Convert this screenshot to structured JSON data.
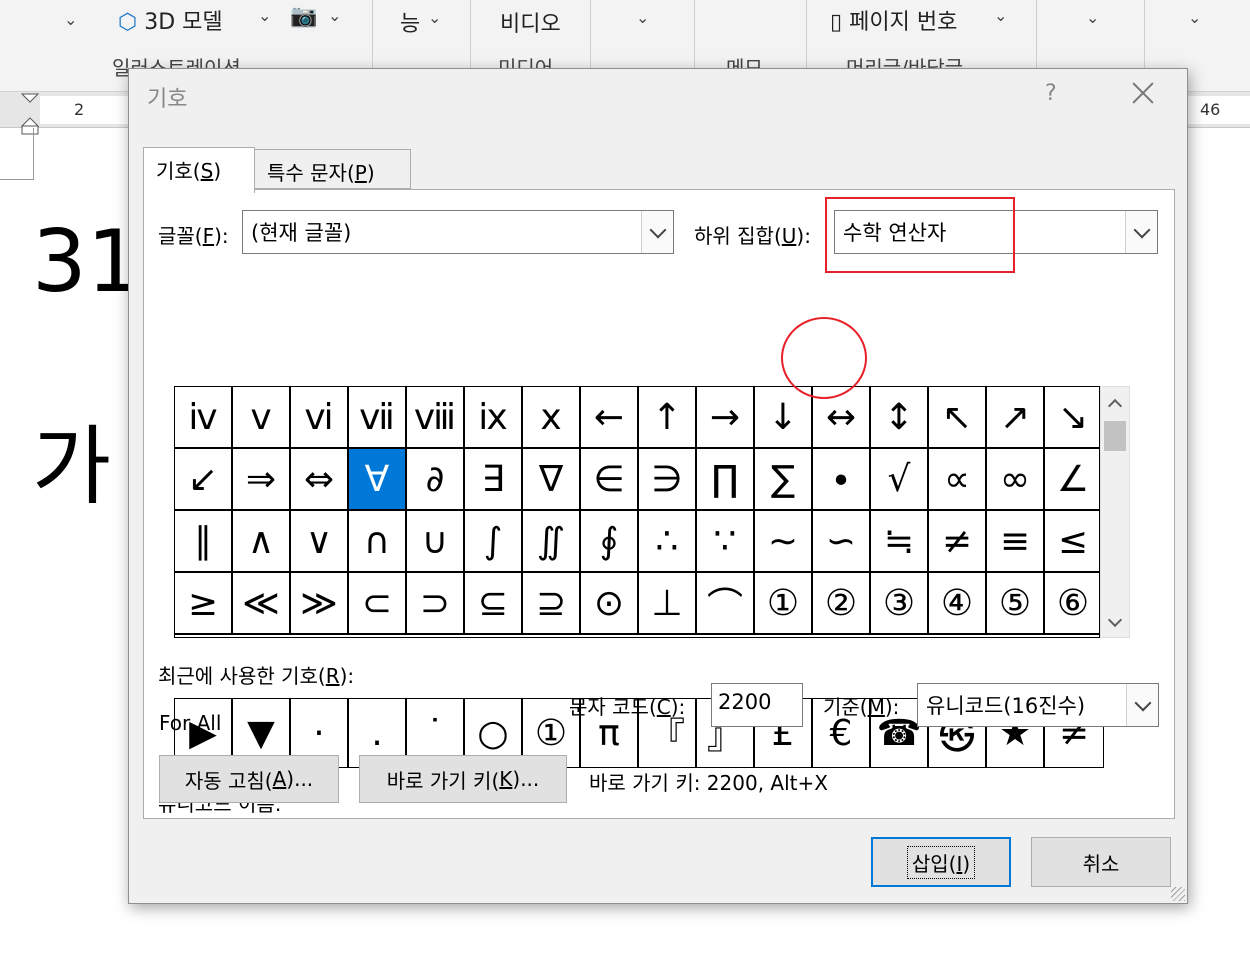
{
  "ribbon": {
    "model_3d_label": "3D 모델",
    "functions_label": "능",
    "video_label": "비디오",
    "page_number_label": "페이지 번호",
    "group_illustrations": "일러스트레이션",
    "group_media": "미디어",
    "group_memo": "메모",
    "group_header_footer": "머리글/바닥글"
  },
  "ruler": {
    "left_num": "2",
    "right_num": "46"
  },
  "document": {
    "line1": "31",
    "line2": "가"
  },
  "dialog": {
    "title": "기호",
    "help": "?",
    "tabs": [
      {
        "label": "기호(",
        "key": "S",
        "suffix": ")"
      },
      {
        "label": "특수 문자(",
        "key": "P",
        "suffix": ")"
      }
    ],
    "font_label": {
      "text": "글꼴(",
      "key": "F",
      "suffix": "):"
    },
    "font_value": "(현재 글꼴)",
    "subset_label": {
      "text": "하위 집합(",
      "key": "U",
      "suffix": "):"
    },
    "subset_value": "수학 연산자",
    "symbols": [
      "ⅳ",
      "ⅴ",
      "ⅵ",
      "ⅶ",
      "ⅷ",
      "ⅸ",
      "ⅹ",
      "←",
      "↑",
      "→",
      "↓",
      "↔",
      "↕",
      "↖",
      "↗",
      "↘",
      "↙",
      "⇒",
      "⇔",
      "∀",
      "∂",
      "∃",
      "∇",
      "∈",
      "∋",
      "∏",
      "∑",
      "∙",
      "√",
      "∝",
      "∞",
      "∠",
      "∥",
      "∧",
      "∨",
      "∩",
      "∪",
      "∫",
      "∬",
      "∮",
      "∴",
      "∵",
      "∼",
      "∽",
      "≒",
      "≠",
      "≡",
      "≤",
      "≥",
      "≪",
      "≫",
      "⊂",
      "⊃",
      "⊆",
      "⊇",
      "⊙",
      "⊥",
      "⌒",
      "①",
      "②",
      "③",
      "④",
      "⑤",
      "⑥"
    ],
    "selected_symbol": "∀",
    "recent_label": {
      "text": "최근에 사용한 기호(",
      "key": "R",
      "suffix": "):"
    },
    "recent_symbols": [
      "▶",
      "▼",
      "·",
      "․",
      "˙",
      "○",
      "①",
      "π",
      "『",
      "』",
      "£",
      "€",
      "☎",
      "㉿",
      "★",
      "≠"
    ],
    "unicode_name_label": "유니코드 이름:",
    "unicode_name_value": "For All",
    "char_code_label": {
      "text": "문자 코드(",
      "key": "C",
      "suffix": "):"
    },
    "char_code_value": "2200",
    "from_label": {
      "text": "기준(",
      "key": "M",
      "suffix": "):"
    },
    "from_value": "유니코드(16진수)",
    "autocorrect_button": {
      "text": "자동 고침(",
      "key": "A",
      "suffix": ")..."
    },
    "shortcut_key_button": {
      "text": "바로 가기 키(",
      "key": "K",
      "suffix": ")..."
    },
    "shortcut_info": "바로 가기 키: 2200, Alt+X",
    "insert_button": {
      "text": "삽입(",
      "key": "I",
      "suffix": ")"
    },
    "cancel_button": "취소"
  },
  "colors": {
    "selection": "#0078d7",
    "highlight": "#e8202a"
  }
}
